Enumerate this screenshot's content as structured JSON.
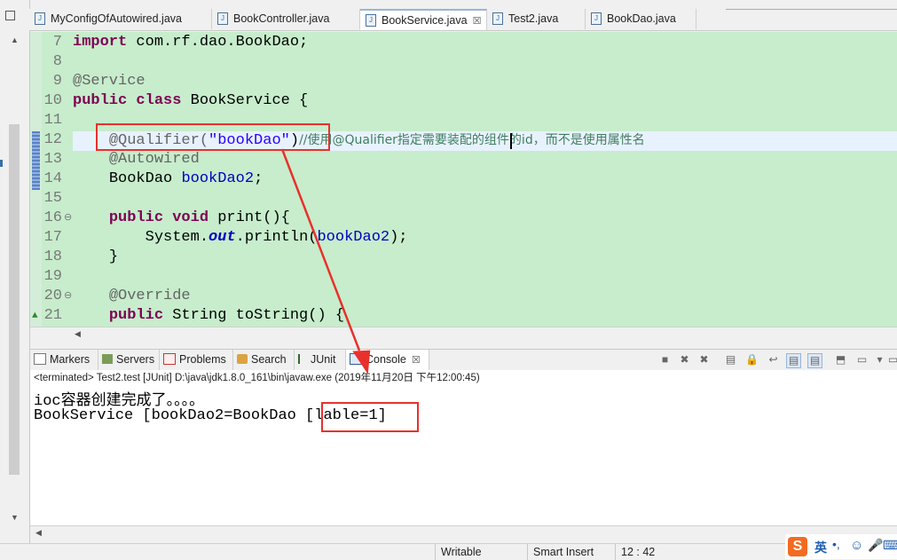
{
  "editor_tabs": [
    {
      "label": "MyConfigOfAutowired.java",
      "active": false
    },
    {
      "label": "BookController.java",
      "active": false
    },
    {
      "label": "BookService.java",
      "active": true
    },
    {
      "label": "Test2.java",
      "active": false
    },
    {
      "label": "BookDao.java",
      "active": false
    }
  ],
  "close_glyph": "☒",
  "code_lines": [
    {
      "n": "7"
    },
    {
      "n": "8"
    },
    {
      "n": "9"
    },
    {
      "n": "10"
    },
    {
      "n": "11"
    },
    {
      "n": "12"
    },
    {
      "n": "13"
    },
    {
      "n": "14"
    },
    {
      "n": "15"
    },
    {
      "n": "16"
    },
    {
      "n": "17"
    },
    {
      "n": "18"
    },
    {
      "n": "19"
    },
    {
      "n": "20"
    },
    {
      "n": "21"
    }
  ],
  "code": {
    "l7_kw": "import",
    "l7_rest": " com.rf.dao.BookDao;",
    "l9_ann": "@Service",
    "l10_kw": "public class",
    "l10_rest": " BookService {",
    "l12_ann": "@Qualifier(",
    "l12_str": "\"bookDao\"",
    "l12_close": ")",
    "l12_cmt": "//使用@Qualifier指定需要装配的组件的id，而不是使用属性名",
    "l13_ann": "@Autowired",
    "l14_type": "BookDao ",
    "l14_fld": "bookDao2",
    "l14_end": ";",
    "l16_kw": "public void",
    "l16_rest": " print(){",
    "l17_a": "System.",
    "l17_out": "out",
    "l17_b": ".println(",
    "l17_fld": "bookDao2",
    "l17_c": ");",
    "l18": "}",
    "l20_ann": "@Override",
    "l21_kw": "public",
    "l21_rest": " String toString() {"
  },
  "console_tabs": [
    {
      "label": "Markers"
    },
    {
      "label": "Servers"
    },
    {
      "label": "Problems"
    },
    {
      "label": "Search"
    },
    {
      "label": "JUnit"
    },
    {
      "label": "Console",
      "active": true
    }
  ],
  "console": {
    "status": "<terminated> Test2.test [JUnit] D:\\java\\jdk1.8.0_161\\bin\\javaw.exe (2019年11月20日 下午12:00:45)",
    "line1": "ioc容器创建完成了。。。。",
    "line2": "BookService [bookDao2=BookDao [lable=1]"
  },
  "statusbar": {
    "writable": "Writable",
    "insert": "Smart Insert",
    "position": "12 : 42"
  },
  "ime": {
    "mode": "英"
  },
  "colors": {
    "editor_bg": "#c7edcc",
    "annotation_red": "#e8312c",
    "keyword": "#7f0055",
    "string": "#2a00ff",
    "field": "#0000c0"
  }
}
